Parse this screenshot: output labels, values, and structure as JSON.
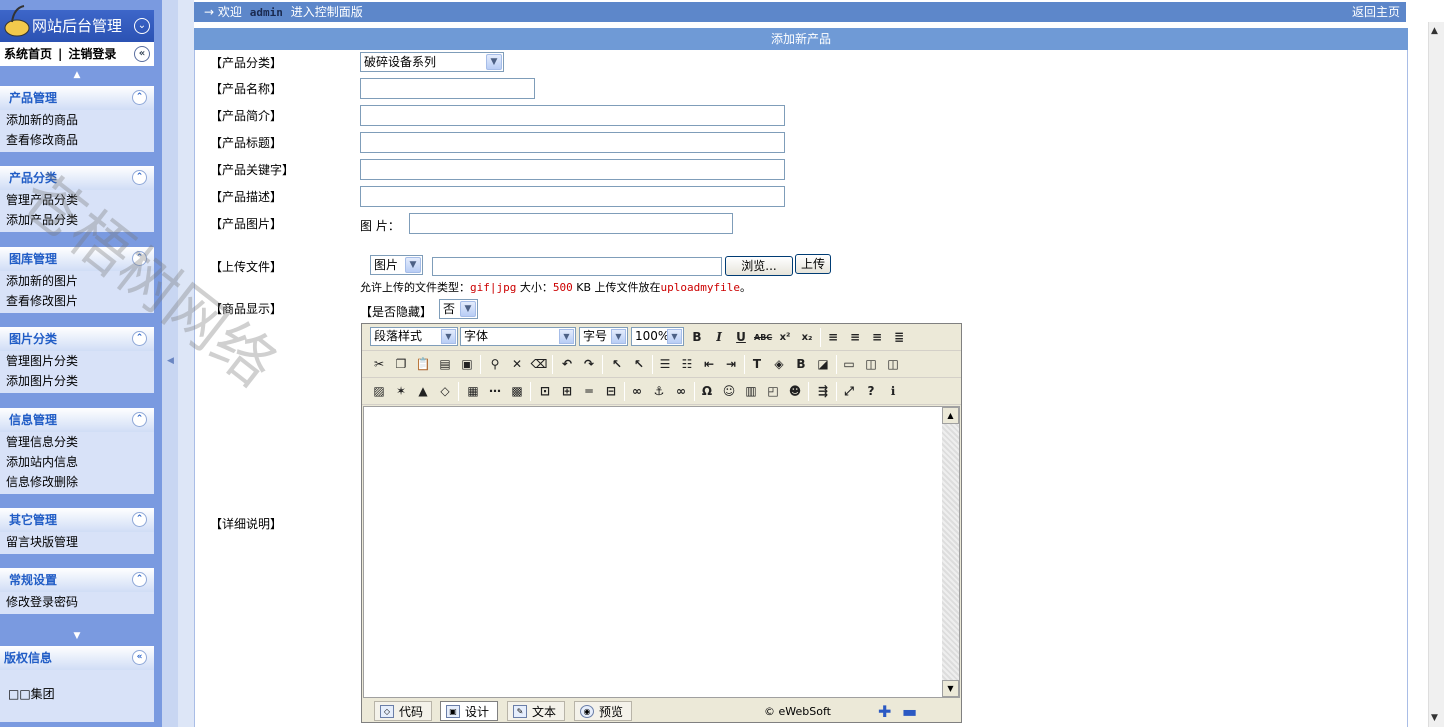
{
  "sidebar": {
    "brand": "网站后台管理",
    "home": "系统首页",
    "logout": "注销登录",
    "groups": [
      {
        "title": "产品管理",
        "items": [
          "添加新的商品",
          "查看修改商品"
        ]
      },
      {
        "title": "产品分类",
        "items": [
          "管理产品分类",
          "添加产品分类"
        ]
      },
      {
        "title": "图库管理",
        "items": [
          "添加新的图片",
          "查看修改图片"
        ]
      },
      {
        "title": "图片分类",
        "items": [
          "管理图片分类",
          "添加图片分类"
        ]
      },
      {
        "title": "信息管理",
        "items": [
          "管理信息分类",
          "添加站内信息",
          "信息修改删除"
        ]
      },
      {
        "title": "其它管理",
        "items": [
          "留言块版管理"
        ]
      },
      {
        "title": "常规设置",
        "items": [
          "修改登录密码"
        ]
      }
    ],
    "copyright": {
      "title": "版权信息",
      "text": "□□集团"
    }
  },
  "topbar": {
    "arrow": "→",
    "welcome": "欢迎",
    "user": "admin",
    "suffix": "进入控制面版",
    "home_link": "返回主页"
  },
  "form": {
    "title": "添加新产品",
    "category_label": "【产品分类】",
    "category_value": "破碎设备系列",
    "name_label": "【产品名称】",
    "intro_label": "【产品简介】",
    "heading_label": "【产品标题】",
    "keywords_label": "【产品关键字】",
    "desc_label": "【产品描述】",
    "image_label": "【产品图片】",
    "image_prefix": "图 片：",
    "upload_label": "【上传文件】",
    "upload_type": "图片",
    "browse": "浏览...",
    "upload": "上传",
    "hint_prefix": "允许上传的文件类型：",
    "hint_types": "gif|jpg",
    "hint_size_prefix": "大小：",
    "hint_size": "500",
    "hint_size_unit": "KB 上传文件放在",
    "hint_dir": "uploadmyfile",
    "hint_end": "。",
    "display_label": "【商品显示】",
    "hidden_label": "【是否隐藏】",
    "hidden_value": "否",
    "detail_label": "【详细说明】"
  },
  "editor": {
    "style_select": "段落样式",
    "font_select": "字体",
    "size_select": "字号",
    "zoom_select": "100%",
    "modes": [
      "代码",
      "设计",
      "文本",
      "预览"
    ],
    "credit": "© eWebSoft"
  },
  "watermark": "苍梧树网络"
}
